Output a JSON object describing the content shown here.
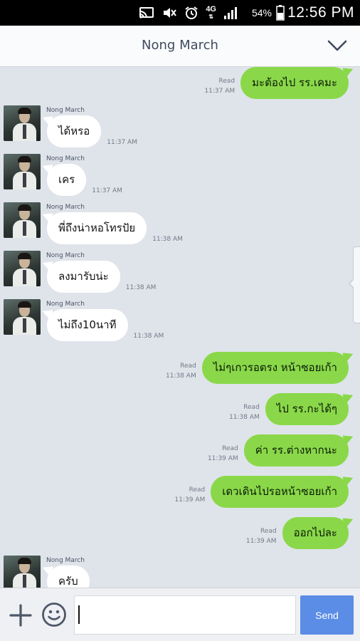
{
  "status_bar": {
    "battery": "54%",
    "time": "12:56 PM",
    "network": "4G",
    "icons": [
      "cast-icon",
      "mute-icon",
      "alarm-icon",
      "network-4g-icon",
      "signal-icon",
      "battery-icon"
    ]
  },
  "header": {
    "title": "Nong March",
    "menu_icon": "chevron-down-icon"
  },
  "messages": [
    {
      "dir": "out",
      "text": "มะต้องไป รร.เคมะ",
      "read": "Read",
      "time": "11:37 AM"
    },
    {
      "dir": "in",
      "sender": "Nong March",
      "text": "ได้หรอ",
      "time": "11:37 AM"
    },
    {
      "dir": "in",
      "sender": "Nong March",
      "text": "เคร",
      "time": "11:37 AM"
    },
    {
      "dir": "in",
      "sender": "Nong March",
      "text": "พี่ถึงน่าหอโทรปัย",
      "time": "11:38 AM"
    },
    {
      "dir": "in",
      "sender": "Nong March",
      "text": "ลงมารับน่ะ",
      "time": "11:38 AM"
    },
    {
      "dir": "in",
      "sender": "Nong March",
      "text": "ไม่ถึง10นาที",
      "time": "11:38 AM"
    },
    {
      "dir": "out",
      "text": "ไม่ๆเกวรอตรง หน้าซอยเก้า",
      "read": "Read",
      "time": "11:38 AM"
    },
    {
      "dir": "out",
      "text": "ไป รร.กะได้ๆ",
      "read": "Read",
      "time": "11:38 AM"
    },
    {
      "dir": "out",
      "text": "ค่า รร.ต่างหากนะ",
      "read": "Read",
      "time": "11:39 AM"
    },
    {
      "dir": "out",
      "text": "เดวเดินไปรอหน้าซอยเก้า",
      "read": "Read",
      "time": "11:39 AM"
    },
    {
      "dir": "out",
      "text": "ออกไปละ",
      "read": "Read",
      "time": "11:39 AM"
    },
    {
      "dir": "in",
      "sender": "Nong March",
      "text": "ครับ",
      "time": ""
    }
  ],
  "input": {
    "value": "",
    "send_label": "Send"
  },
  "colors": {
    "outgoing_bubble": "#8ad84a",
    "incoming_bubble": "#ffffff",
    "chat_background": "#dfe4ea",
    "send_button": "#5b8ce6"
  }
}
